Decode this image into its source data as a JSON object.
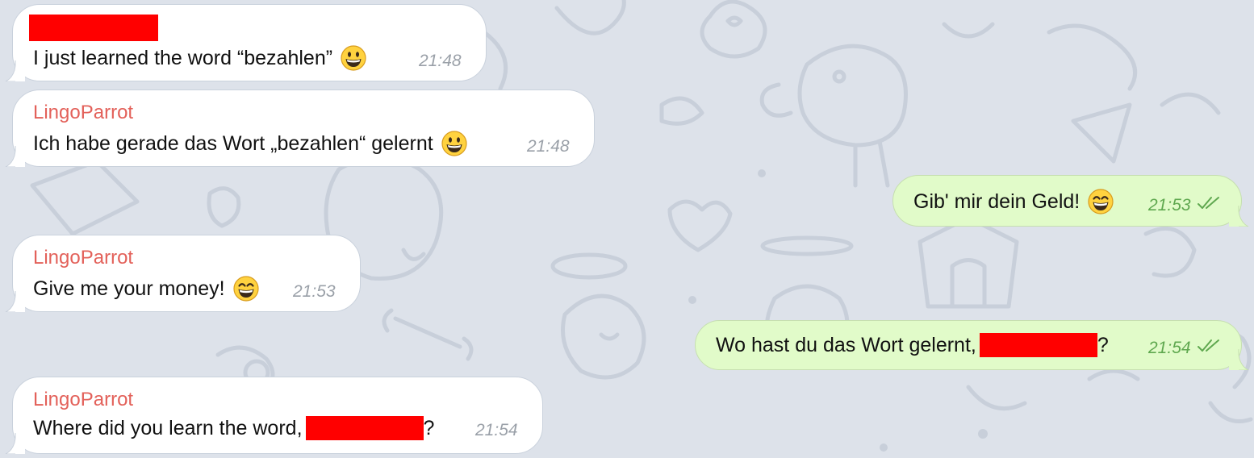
{
  "messages": [
    {
      "direction": "incoming",
      "sender": "",
      "sender_redacted": true,
      "text": "I just learned the word “bezahlen”",
      "emoji": "grinning-face",
      "time": "21:48"
    },
    {
      "direction": "incoming",
      "sender": "LingoParrot",
      "text": "Ich habe gerade das Wort „bezahlen“ gelernt",
      "emoji": "grinning-face",
      "time": "21:48"
    },
    {
      "direction": "outgoing",
      "text": "Gib' mir dein Geld!",
      "emoji": "grinning-face-with-smiling-eyes",
      "time": "21:53",
      "read": true
    },
    {
      "direction": "incoming",
      "sender": "LingoParrot",
      "text": "Give me your money!",
      "emoji": "grinning-face-with-smiling-eyes",
      "time": "21:53"
    },
    {
      "direction": "outgoing",
      "text_before": "Wo hast du das Wort gelernt,",
      "text_after": "?",
      "redacted_segment": true,
      "time": "21:54",
      "read": true
    },
    {
      "direction": "incoming",
      "sender": "LingoParrot",
      "text_before": "Where did you learn the word,",
      "text_after": "?",
      "redacted_segment": true,
      "time": "21:54"
    }
  ],
  "colors": {
    "background": "#dde2ea",
    "incoming_bubble": "#ffffff",
    "outgoing_bubble": "#e1fbc9",
    "sender_name": "#e3615a",
    "time_incoming": "#9aa0a8",
    "time_outgoing": "#5fa84f",
    "redaction": "#ff0000"
  },
  "icons": {
    "read_receipt": "double-check-icon",
    "wallpaper": "doodle-pattern"
  }
}
